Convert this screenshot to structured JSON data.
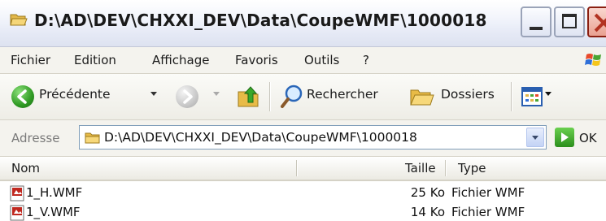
{
  "window": {
    "title": "D:\\AD\\DEV\\CHXXI_DEV\\Data\\CoupeWMF\\1000018"
  },
  "menu": {
    "items": [
      "Fichier",
      "Edition",
      "Affichage",
      "Favoris",
      "Outils",
      "?"
    ]
  },
  "toolbar": {
    "back_label": "Précédente",
    "search_label": "Rechercher",
    "folders_label": "Dossiers"
  },
  "address": {
    "label": "Adresse",
    "value": "D:\\AD\\DEV\\CHXXI_DEV\\Data\\CoupeWMF\\1000018",
    "go_label": "OK"
  },
  "list": {
    "columns": [
      "Nom",
      "Taille",
      "Type"
    ],
    "rows": [
      {
        "name": "1_H.WMF",
        "size": "25 Ko",
        "type": "Fichier WMF"
      },
      {
        "name": "1_V.WMF",
        "size": "14 Ko",
        "type": "Fichier WMF"
      }
    ]
  },
  "icons": {
    "title": "folder-open-icon",
    "back": "back-arrow-icon",
    "forward": "forward-arrow-icon",
    "up": "folder-up-icon",
    "search": "search-icon",
    "folders": "folders-icon",
    "views": "views-icon",
    "address": "folder-icon",
    "go": "go-arrow-icon",
    "file": "wmf-file-icon",
    "brand": "windows-logo-icon"
  },
  "colors": {
    "accent_blue": "#316ac5",
    "go_green": "#2c8f1c",
    "close_red": "#b23322"
  }
}
